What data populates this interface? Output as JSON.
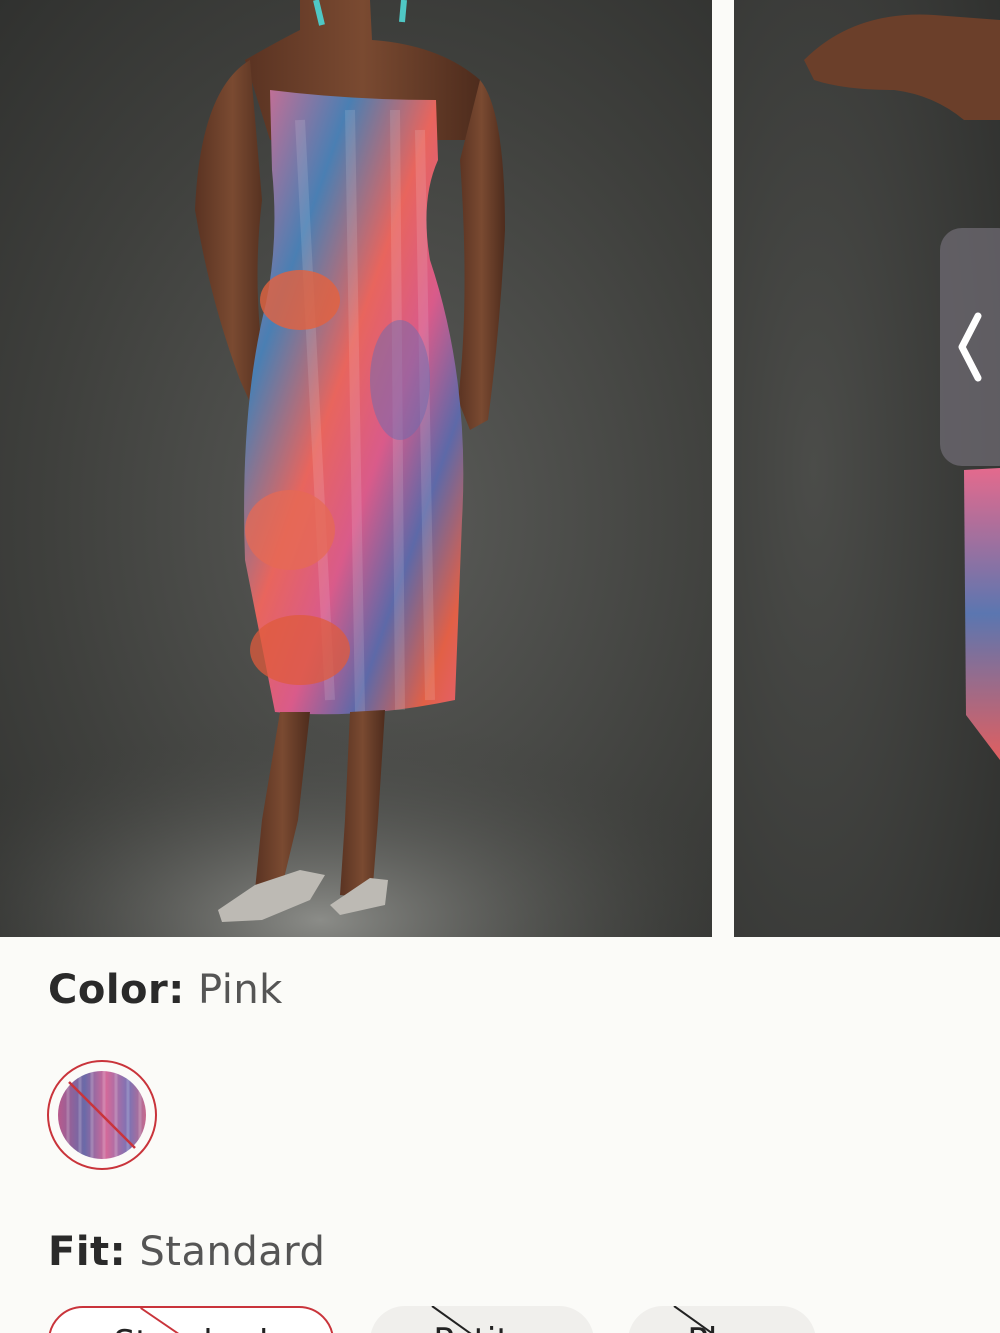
{
  "gallery": {
    "prev_icon": "chevron-left-icon",
    "images": [
      {
        "name": "product-photo-front"
      },
      {
        "name": "product-photo-back"
      }
    ]
  },
  "color": {
    "key": "Color:",
    "value": "Pink",
    "swatches": [
      {
        "name": "pink",
        "unavailable_mark": true,
        "selected": true
      }
    ]
  },
  "fit": {
    "key": "Fit:",
    "value": "Standard",
    "options": [
      {
        "label": "Standard",
        "selected": true,
        "unavailable": true
      },
      {
        "label": "Petite",
        "selected": false,
        "unavailable": true
      },
      {
        "label": "Plus",
        "selected": false,
        "unavailable": true
      }
    ]
  },
  "colors": {
    "accent_red": "#c9343b",
    "background": "#fbfbf8",
    "studio_gray": "#3e3f3c"
  }
}
